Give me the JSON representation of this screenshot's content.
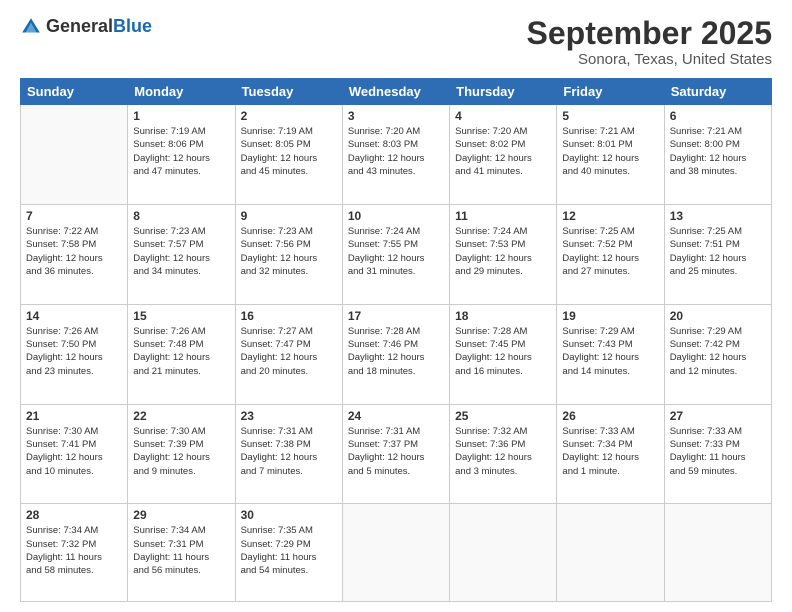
{
  "logo": {
    "text_general": "General",
    "text_blue": "Blue"
  },
  "title": "September 2025",
  "subtitle": "Sonora, Texas, United States",
  "days_of_week": [
    "Sunday",
    "Monday",
    "Tuesday",
    "Wednesday",
    "Thursday",
    "Friday",
    "Saturday"
  ],
  "weeks": [
    [
      {
        "day": "",
        "info": ""
      },
      {
        "day": "1",
        "info": "Sunrise: 7:19 AM\nSunset: 8:06 PM\nDaylight: 12 hours\nand 47 minutes."
      },
      {
        "day": "2",
        "info": "Sunrise: 7:19 AM\nSunset: 8:05 PM\nDaylight: 12 hours\nand 45 minutes."
      },
      {
        "day": "3",
        "info": "Sunrise: 7:20 AM\nSunset: 8:03 PM\nDaylight: 12 hours\nand 43 minutes."
      },
      {
        "day": "4",
        "info": "Sunrise: 7:20 AM\nSunset: 8:02 PM\nDaylight: 12 hours\nand 41 minutes."
      },
      {
        "day": "5",
        "info": "Sunrise: 7:21 AM\nSunset: 8:01 PM\nDaylight: 12 hours\nand 40 minutes."
      },
      {
        "day": "6",
        "info": "Sunrise: 7:21 AM\nSunset: 8:00 PM\nDaylight: 12 hours\nand 38 minutes."
      }
    ],
    [
      {
        "day": "7",
        "info": "Sunrise: 7:22 AM\nSunset: 7:58 PM\nDaylight: 12 hours\nand 36 minutes."
      },
      {
        "day": "8",
        "info": "Sunrise: 7:23 AM\nSunset: 7:57 PM\nDaylight: 12 hours\nand 34 minutes."
      },
      {
        "day": "9",
        "info": "Sunrise: 7:23 AM\nSunset: 7:56 PM\nDaylight: 12 hours\nand 32 minutes."
      },
      {
        "day": "10",
        "info": "Sunrise: 7:24 AM\nSunset: 7:55 PM\nDaylight: 12 hours\nand 31 minutes."
      },
      {
        "day": "11",
        "info": "Sunrise: 7:24 AM\nSunset: 7:53 PM\nDaylight: 12 hours\nand 29 minutes."
      },
      {
        "day": "12",
        "info": "Sunrise: 7:25 AM\nSunset: 7:52 PM\nDaylight: 12 hours\nand 27 minutes."
      },
      {
        "day": "13",
        "info": "Sunrise: 7:25 AM\nSunset: 7:51 PM\nDaylight: 12 hours\nand 25 minutes."
      }
    ],
    [
      {
        "day": "14",
        "info": "Sunrise: 7:26 AM\nSunset: 7:50 PM\nDaylight: 12 hours\nand 23 minutes."
      },
      {
        "day": "15",
        "info": "Sunrise: 7:26 AM\nSunset: 7:48 PM\nDaylight: 12 hours\nand 21 minutes."
      },
      {
        "day": "16",
        "info": "Sunrise: 7:27 AM\nSunset: 7:47 PM\nDaylight: 12 hours\nand 20 minutes."
      },
      {
        "day": "17",
        "info": "Sunrise: 7:28 AM\nSunset: 7:46 PM\nDaylight: 12 hours\nand 18 minutes."
      },
      {
        "day": "18",
        "info": "Sunrise: 7:28 AM\nSunset: 7:45 PM\nDaylight: 12 hours\nand 16 minutes."
      },
      {
        "day": "19",
        "info": "Sunrise: 7:29 AM\nSunset: 7:43 PM\nDaylight: 12 hours\nand 14 minutes."
      },
      {
        "day": "20",
        "info": "Sunrise: 7:29 AM\nSunset: 7:42 PM\nDaylight: 12 hours\nand 12 minutes."
      }
    ],
    [
      {
        "day": "21",
        "info": "Sunrise: 7:30 AM\nSunset: 7:41 PM\nDaylight: 12 hours\nand 10 minutes."
      },
      {
        "day": "22",
        "info": "Sunrise: 7:30 AM\nSunset: 7:39 PM\nDaylight: 12 hours\nand 9 minutes."
      },
      {
        "day": "23",
        "info": "Sunrise: 7:31 AM\nSunset: 7:38 PM\nDaylight: 12 hours\nand 7 minutes."
      },
      {
        "day": "24",
        "info": "Sunrise: 7:31 AM\nSunset: 7:37 PM\nDaylight: 12 hours\nand 5 minutes."
      },
      {
        "day": "25",
        "info": "Sunrise: 7:32 AM\nSunset: 7:36 PM\nDaylight: 12 hours\nand 3 minutes."
      },
      {
        "day": "26",
        "info": "Sunrise: 7:33 AM\nSunset: 7:34 PM\nDaylight: 12 hours\nand 1 minute."
      },
      {
        "day": "27",
        "info": "Sunrise: 7:33 AM\nSunset: 7:33 PM\nDaylight: 11 hours\nand 59 minutes."
      }
    ],
    [
      {
        "day": "28",
        "info": "Sunrise: 7:34 AM\nSunset: 7:32 PM\nDaylight: 11 hours\nand 58 minutes."
      },
      {
        "day": "29",
        "info": "Sunrise: 7:34 AM\nSunset: 7:31 PM\nDaylight: 11 hours\nand 56 minutes."
      },
      {
        "day": "30",
        "info": "Sunrise: 7:35 AM\nSunset: 7:29 PM\nDaylight: 11 hours\nand 54 minutes."
      },
      {
        "day": "",
        "info": ""
      },
      {
        "day": "",
        "info": ""
      },
      {
        "day": "",
        "info": ""
      },
      {
        "day": "",
        "info": ""
      }
    ]
  ]
}
